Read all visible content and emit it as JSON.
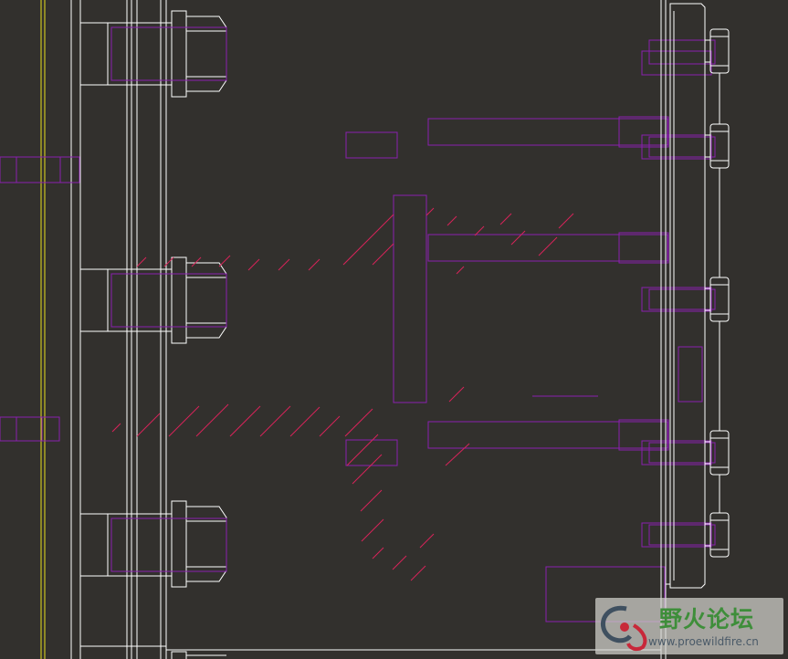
{
  "viewport": {
    "background": "#32302d",
    "colors": {
      "outline": "#ffffff",
      "construction": "#8a1fb0",
      "hatch": "#d8245a",
      "centerline": "#e8e020"
    }
  },
  "watermark": {
    "title": "野火论坛",
    "url": "www.proewildfire.cn",
    "logo_icon": "wildfire-logo-icon"
  }
}
